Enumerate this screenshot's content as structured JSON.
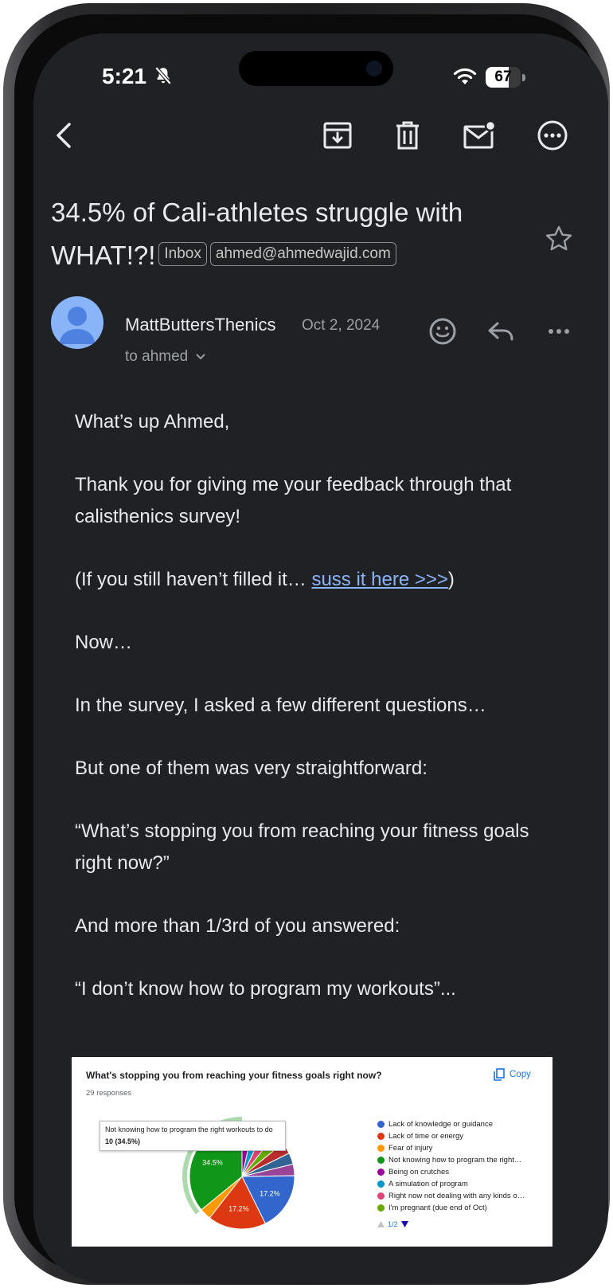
{
  "status": {
    "time": "5:21",
    "battery": "67",
    "battery_level": 0.67
  },
  "toolbar": {
    "back": "back-arrow-icon",
    "archive": "archive-icon",
    "delete": "trash-icon",
    "mark_unread": "mail-unread-icon",
    "more": "more-circle-icon"
  },
  "email": {
    "subject": "34.5% of Cali-athletes struggle with WHAT!?!",
    "labels": [
      "Inbox",
      "ahmed@ahmedwajid.com"
    ],
    "sender": "MattButtersThenics",
    "date": "Oct 2, 2024",
    "to": "to ahmed",
    "body": {
      "greeting": "What’s up Ahmed,",
      "p1": "Thank you for giving me your feedback through that calisthenics survey!",
      "p2_prefix": "(If you still haven’t filled it… ",
      "p2_link": "suss it here >>>",
      "p2_suffix": ")",
      "p3": "Now…",
      "p4": "In the survey, I asked a few different questions…",
      "p5": "But one of them was very straightforward:",
      "p6": "“What’s stopping you from reaching your fitness goals right now?”",
      "p7": "And more than 1/3rd of you answered:",
      "p8": "“I don’t know how to program my workouts”..."
    }
  },
  "chart_data": {
    "type": "pie",
    "title": "What's stopping you from reaching your fitness goals right now?",
    "subtitle": "29 responses",
    "copy_label": "Copy",
    "categories": [
      "Lack of knowledge or guidance",
      "Lack of time or energy",
      "Fear of injury",
      "Not knowing how to program the right…",
      "Being on crutches",
      "A simulation of program",
      "Right now not dealing with any kinds o…",
      "I'm pregnant (due end of Oct)"
    ],
    "colors": [
      "#3366cc",
      "#dc3912",
      "#ff9900",
      "#109618",
      "#990099",
      "#0099c6",
      "#dd4477",
      "#66aa00"
    ],
    "values": [
      17.2,
      17.2,
      3.4,
      34.5,
      3.4,
      3.4,
      3.4,
      3.4
    ],
    "pie_labels": [
      "17.2%",
      "17.2%",
      "",
      "34.5%",
      "",
      "",
      "",
      ""
    ],
    "extra_slices": [
      {
        "color": "#b82e2e",
        "value": 3.4
      },
      {
        "color": "#316395",
        "value": 3.4
      },
      {
        "color": "#994499",
        "value": 3.4
      }
    ],
    "tooltip": {
      "text": "Not knowing how to program the right workouts to do",
      "value": "10 (34.5%)"
    },
    "pager": "1/2",
    "legend_position": "right"
  }
}
